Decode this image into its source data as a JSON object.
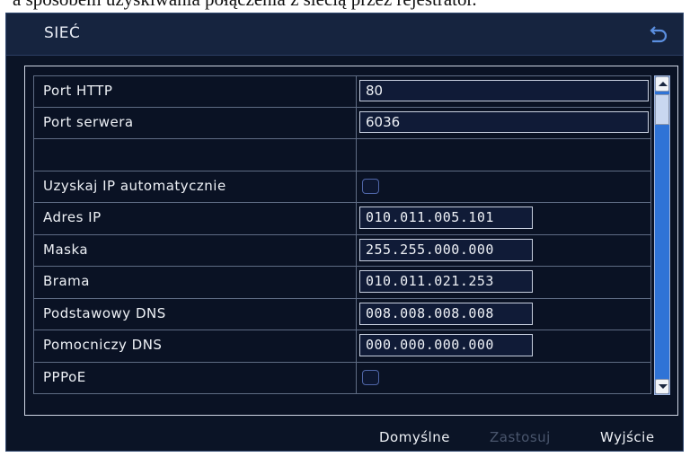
{
  "top_text": "a sposobem uzyskiwania połączenia z siecią przez rejestrator.",
  "window": {
    "title": "SIEĆ",
    "back_icon": "return-arrow-icon"
  },
  "settings": [
    {
      "label": "Port HTTP",
      "type": "text",
      "value": "80"
    },
    {
      "label": "Port serwera",
      "type": "text",
      "value": "6036"
    },
    {
      "label": "",
      "type": "empty",
      "value": ""
    },
    {
      "label": "Uzyskaj IP automatycznie",
      "type": "checkbox",
      "checked": false
    },
    {
      "label": "Adres IP",
      "type": "ip",
      "value": "010.011.005.101"
    },
    {
      "label": "Maska",
      "type": "ip",
      "value": "255.255.000.000"
    },
    {
      "label": "Brama",
      "type": "ip",
      "value": "010.011.021.253"
    },
    {
      "label": "Podstawowy DNS",
      "type": "ip",
      "value": "008.008.008.008"
    },
    {
      "label": "Pomocniczy DNS",
      "type": "ip",
      "value": "000.000.000.000"
    },
    {
      "label": "PPPoE",
      "type": "checkbox",
      "checked": false
    }
  ],
  "scrollbar": {
    "up_icon": "scroll-up-arrow-icon",
    "down_icon": "scroll-down-arrow-icon"
  },
  "footer": {
    "default_label": "Domyślne",
    "apply_label": "Zastosuj",
    "apply_enabled": false,
    "exit_label": "Wyjście"
  },
  "colors": {
    "window_bg": "#0b1426",
    "scrollbar": "#2f73d6",
    "text": "#eef1f6",
    "disabled_text": "#4a566d"
  }
}
